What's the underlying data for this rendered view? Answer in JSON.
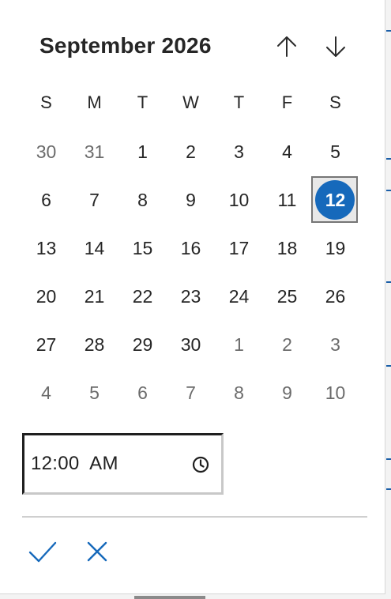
{
  "header": {
    "month_title": "September 2026",
    "prev_icon": "arrow-up-icon",
    "next_icon": "arrow-down-icon"
  },
  "weekdays": [
    "S",
    "M",
    "T",
    "W",
    "T",
    "F",
    "S"
  ],
  "days": [
    {
      "label": "30",
      "in_month": false
    },
    {
      "label": "31",
      "in_month": false
    },
    {
      "label": "1",
      "in_month": true
    },
    {
      "label": "2",
      "in_month": true
    },
    {
      "label": "3",
      "in_month": true
    },
    {
      "label": "4",
      "in_month": true
    },
    {
      "label": "5",
      "in_month": true
    },
    {
      "label": "6",
      "in_month": true
    },
    {
      "label": "7",
      "in_month": true
    },
    {
      "label": "8",
      "in_month": true
    },
    {
      "label": "9",
      "in_month": true
    },
    {
      "label": "10",
      "in_month": true
    },
    {
      "label": "11",
      "in_month": true
    },
    {
      "label": "12",
      "in_month": true,
      "selected": true
    },
    {
      "label": "13",
      "in_month": true
    },
    {
      "label": "14",
      "in_month": true
    },
    {
      "label": "15",
      "in_month": true
    },
    {
      "label": "16",
      "in_month": true
    },
    {
      "label": "17",
      "in_month": true
    },
    {
      "label": "18",
      "in_month": true
    },
    {
      "label": "19",
      "in_month": true
    },
    {
      "label": "20",
      "in_month": true
    },
    {
      "label": "21",
      "in_month": true
    },
    {
      "label": "22",
      "in_month": true
    },
    {
      "label": "23",
      "in_month": true
    },
    {
      "label": "24",
      "in_month": true
    },
    {
      "label": "25",
      "in_month": true
    },
    {
      "label": "26",
      "in_month": true
    },
    {
      "label": "27",
      "in_month": true
    },
    {
      "label": "28",
      "in_month": true
    },
    {
      "label": "29",
      "in_month": true
    },
    {
      "label": "30",
      "in_month": true
    },
    {
      "label": "1",
      "in_month": false
    },
    {
      "label": "2",
      "in_month": false
    },
    {
      "label": "3",
      "in_month": false
    },
    {
      "label": "4",
      "in_month": false
    },
    {
      "label": "5",
      "in_month": false
    },
    {
      "label": "6",
      "in_month": false
    },
    {
      "label": "7",
      "in_month": false
    },
    {
      "label": "8",
      "in_month": false
    },
    {
      "label": "9",
      "in_month": false
    },
    {
      "label": "10",
      "in_month": false
    }
  ],
  "time": {
    "value": "12:00  AM",
    "icon": "clock-icon"
  },
  "actions": {
    "accept_icon": "checkmark-icon",
    "dismiss_icon": "close-icon"
  },
  "colors": {
    "accent": "#1669bb",
    "text": "#262626",
    "out_of_month_text": "#6b6b6b",
    "divider": "#cfcfcf"
  }
}
